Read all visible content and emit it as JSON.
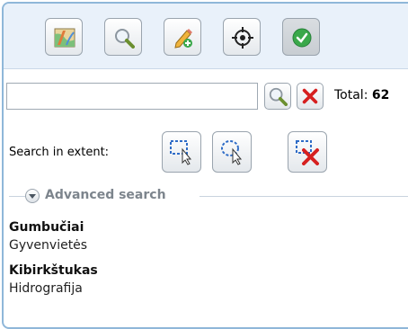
{
  "toolbar": {
    "buttons": [
      {
        "icon": "map-icon"
      },
      {
        "icon": "magnifier-icon"
      },
      {
        "icon": "pencil-add-icon"
      },
      {
        "icon": "target-icon"
      },
      {
        "icon": "green-check-icon",
        "active": true
      }
    ]
  },
  "search": {
    "value": "",
    "placeholder": "",
    "search_icon": "magnifier-icon",
    "clear_icon": "red-x-icon",
    "total_label": "Total:",
    "total_count": "62"
  },
  "extent": {
    "label": "Search in extent:",
    "icons": [
      "rectangle-select-icon",
      "lasso-select-icon",
      "clear-selection-icon"
    ]
  },
  "advanced": {
    "label": "Advanced search",
    "icon": "chevron-down-icon"
  },
  "results": [
    {
      "title": "Gumbučiai",
      "subtitle": "Gyvenvietės"
    },
    {
      "title": "Kibirkštukas",
      "subtitle": "Hidrografija"
    }
  ],
  "colors": {
    "border": "#8fb7d9",
    "toolbar_bg": "#e9f1fa",
    "clear_red": "#d62020",
    "check_green": "#3aa84a"
  }
}
